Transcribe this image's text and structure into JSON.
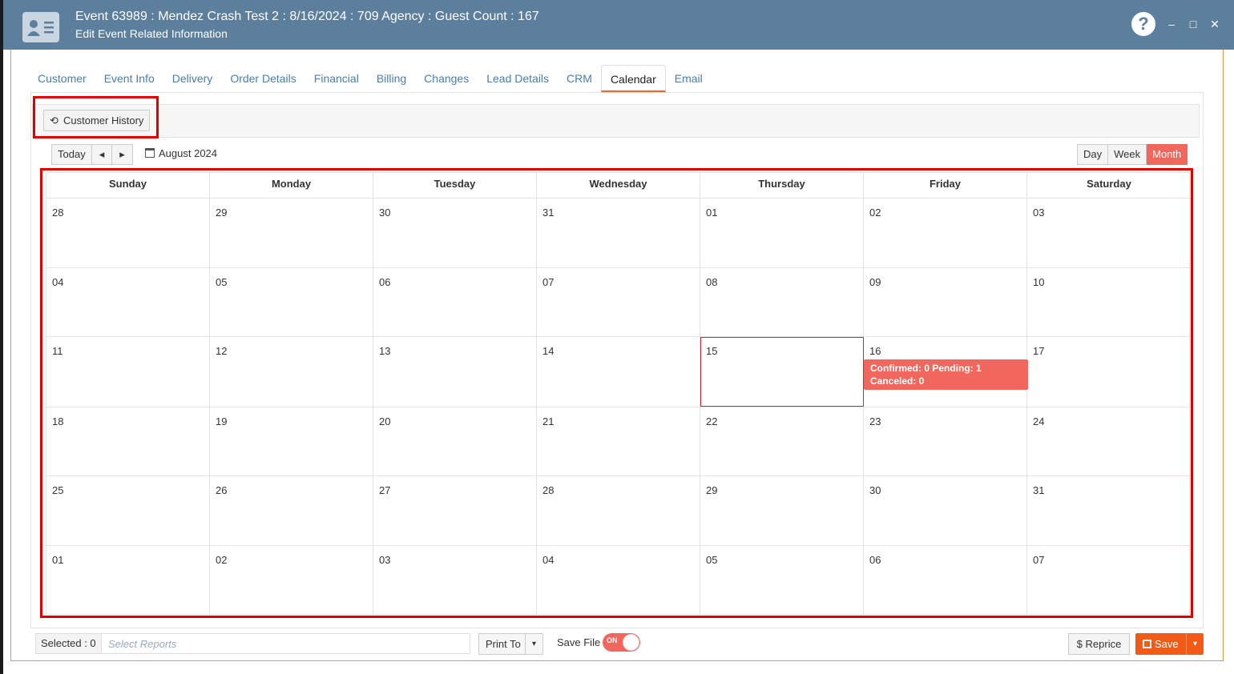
{
  "window": {
    "title": "Event 63989 : Mendez Crash Test 2 : 8/16/2024 : 709 Agency : Guest Count : 167",
    "subtitle": "Edit Event Related Information",
    "help_label": "?",
    "minimize_label": "–",
    "maximize_label": "□",
    "close_label": "✕"
  },
  "tabs": [
    {
      "label": "Customer",
      "active": false
    },
    {
      "label": "Event Info",
      "active": false
    },
    {
      "label": "Delivery",
      "active": false
    },
    {
      "label": "Order Details",
      "active": false
    },
    {
      "label": "Financial",
      "active": false
    },
    {
      "label": "Billing",
      "active": false
    },
    {
      "label": "Changes",
      "active": false
    },
    {
      "label": "Lead Details",
      "active": false
    },
    {
      "label": "CRM",
      "active": false
    },
    {
      "label": "Calendar",
      "active": true
    },
    {
      "label": "Email",
      "active": false
    }
  ],
  "toolbar": {
    "customer_history_label": "Customer History",
    "history_icon": "⟲"
  },
  "calendar_nav": {
    "today_label": "Today",
    "prev_label": "◂",
    "next_label": "▸",
    "month_label": "August 2024",
    "views": [
      "Day",
      "Week",
      "Month"
    ],
    "active_view": "Month"
  },
  "calendar": {
    "days_of_week": [
      "Sunday",
      "Monday",
      "Tuesday",
      "Wednesday",
      "Thursday",
      "Friday",
      "Saturday"
    ],
    "weeks": [
      [
        "28",
        "29",
        "30",
        "31",
        "01",
        "02",
        "03"
      ],
      [
        "04",
        "05",
        "06",
        "07",
        "08",
        "09",
        "10"
      ],
      [
        "11",
        "12",
        "13",
        "14",
        "15",
        "16",
        "17"
      ],
      [
        "18",
        "19",
        "20",
        "21",
        "22",
        "23",
        "24"
      ],
      [
        "25",
        "26",
        "27",
        "28",
        "29",
        "30",
        "31"
      ],
      [
        "01",
        "02",
        "03",
        "04",
        "05",
        "06",
        "07"
      ]
    ],
    "today": {
      "week": 2,
      "day": 4
    },
    "event": {
      "week": 2,
      "day": 5,
      "line1": "Confirmed: 0 Pending: 1",
      "line2": "Canceled: 0",
      "color": "#f2675d"
    }
  },
  "bottom": {
    "selected_label": "Selected : 0",
    "select_reports_placeholder": "Select Reports",
    "print_to_label": "Print To",
    "save_file_label": "Save File",
    "toggle_label": "ON",
    "reprice_label": "$  Reprice",
    "save_label": "Save",
    "caret": "▾"
  },
  "colors": {
    "titlebar": "#5b7f9c",
    "accent": "#f25a16",
    "event": "#f2675d",
    "highlight_box": "#e00000"
  }
}
